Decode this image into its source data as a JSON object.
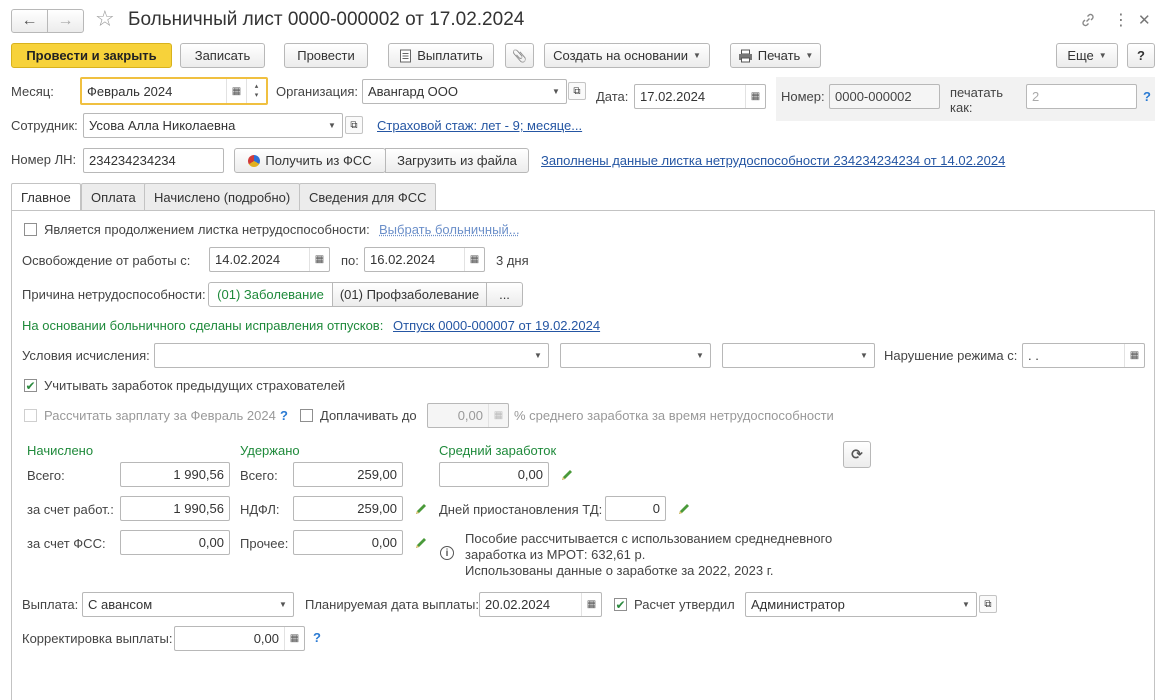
{
  "header": {
    "title": "Больничный лист 0000-000002 от 17.02.2024",
    "back_glyph": "←",
    "forward_glyph": "→",
    "star_glyph": "☆",
    "link_glyph": "🔗",
    "more_glyph": "⋮",
    "close_glyph": "✕"
  },
  "toolbar": {
    "post_close": "Провести и закрыть",
    "save": "Записать",
    "post": "Провести",
    "pay": "Выплатить",
    "attach_glyph": "📎",
    "create_based": "Создать на основании",
    "print": "Печать",
    "more": "Еще",
    "help": "?"
  },
  "top": {
    "month_label": "Месяц:",
    "month_value": "Февраль 2024",
    "org_label": "Организация:",
    "org_value": "Авангард ООО",
    "date_label": "Дата:",
    "date_value": "17.02.2024",
    "number_label": "Номер:",
    "number_value": "0000-000002",
    "print_as_label_1": "печатать",
    "print_as_label_2": "как:",
    "print_as_value": "2",
    "employee_label": "Сотрудник:",
    "employee_value": "Усова Алла Николаевна",
    "insurance_link": "Страховой стаж: лет - 9; месяце...",
    "ln_label": "Номер ЛН:",
    "ln_value": "234234234234",
    "get_fss": "Получить из ФСС",
    "load_file": "Загрузить из файла",
    "filled_link": "Заполнены данные листка нетрудоспособности 234234234234 от 14.02.2024"
  },
  "tabs": [
    {
      "label": "Главное",
      "active": true
    },
    {
      "label": "Оплата",
      "active": false
    },
    {
      "label": "Начислено (подробно)",
      "active": false
    },
    {
      "label": "Сведения для ФСС",
      "active": false
    }
  ],
  "main": {
    "continuation_label": "Является продолжением листка нетрудоспособности:",
    "choose_sick": "Выбрать больничный...",
    "release_label": "Освобождение от работы с:",
    "release_from": "14.02.2024",
    "release_to_label": "по:",
    "release_to": "16.02.2024",
    "days": "3 дня",
    "reason_label": "Причина нетрудоспособности:",
    "reason_option_1": "(01) Заболевание",
    "reason_option_2": "(01) Профзаболевание",
    "reason_more": "...",
    "corrections_label": "На основании больничного сделаны исправления отпусков:",
    "corrections_link": "Отпуск 0000-000007 от 19.02.2024",
    "conditions_label": "Условия исчисления:",
    "conditions_value_1": "",
    "conditions_value_2": "",
    "conditions_value_3": "",
    "violation_label": "Нарушение режима с:",
    "violation_value": " .  .",
    "consider_earnings": "Учитывать заработок предыдущих страхователей",
    "consider_checked": true,
    "calc_salary": "Рассчитать зарплату за Февраль 2024",
    "topup_label": "Доплачивать до",
    "topup_value": "0,00",
    "topup_suffix": "% среднего заработка за время нетрудоспособности"
  },
  "totals": {
    "accrued_header": "Начислено",
    "withheld_header": "Удержано",
    "avg_header": "Средний заработок",
    "total_label": "Всего:",
    "accrued_total": "1 990,56",
    "employer_label": "за счет работ.:",
    "accrued_employer": "1 990,56",
    "fss_label": "за счет ФСС:",
    "accrued_fss": "0,00",
    "withheld_total_label": "Всего:",
    "withheld_total": "259,00",
    "ndfl_label": "НДФЛ:",
    "withheld_ndfl": "259,00",
    "other_label": "Прочее:",
    "withheld_other": "0,00",
    "avg_value": "0,00",
    "suspension_label": "Дней приостановления ТД:",
    "suspension_value": "0",
    "info_line_1": "Пособие рассчитывается с использованием среднедневного",
    "info_line_2": "заработка из МРОТ: 632,61 р.",
    "info_line_3": "Использованы данные о заработке за  2022,  2023 г."
  },
  "payment": {
    "payout_label": "Выплата:",
    "payout_value": "С авансом",
    "plan_date_label": "Планируемая дата выплаты:",
    "plan_date_value": "20.02.2024",
    "approved_label": "Расчет утвердил",
    "approved_checked": true,
    "approved_value": "Администратор",
    "correction_label": "Корректировка выплаты:",
    "correction_value": "0,00"
  }
}
